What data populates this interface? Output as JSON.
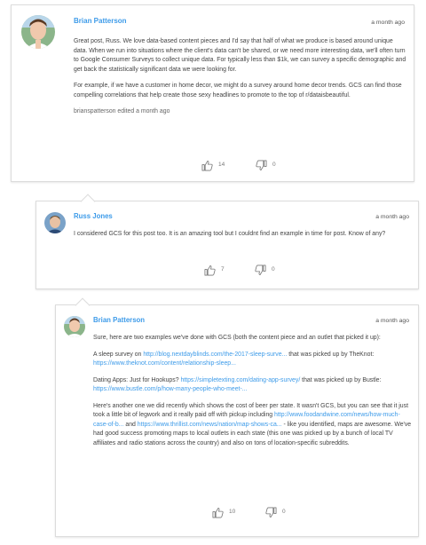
{
  "comments": [
    {
      "author": "Brian Patterson",
      "time": "a month ago",
      "paragraphs": [
        "Great post, Russ. We love data-based content pieces and I'd say that half of what we produce is based around unique data. When we run into situations where the client's data can't be shared, or we need more interesting data, we'll often turn to Google Consumer Surveys to collect unique data. For typically less than $1k, we can survey a specific demographic and get back the statistically significant data we were looking for.",
        "For example, if we have a customer in home decor, we might do a survey around home decor trends. GCS can find those compelling correlations that help create those sexy headlines to promote to the top of r/dataisbeautiful."
      ],
      "edited": "brianspatterson edited a month ago",
      "upvotes": "14",
      "downvotes": "0"
    },
    {
      "author": "Russ Jones",
      "time": "a month ago",
      "paragraphs": [
        "I considered GCS for this post too. It is an amazing tool but I couldnt find an example in time for post. Know of any?"
      ],
      "upvotes": "7",
      "downvotes": "0"
    },
    {
      "author": "Brian Patterson",
      "time": "a month ago",
      "p1": "Sure, here are two examples we've done with GCS (both the content piece and an outlet that picked it up):",
      "p2": {
        "t1": "A sleep survey on ",
        "l1": "http://blog.nextdayblinds.com/the-2017-sleep-surve...",
        "t2": " that was picked up by TheKnot: ",
        "l2": "https://www.theknot.com/content/relationship-sleep..."
      },
      "p3": {
        "t1": "Dating Apps: Just for Hookups? ",
        "l1": "https://simpletexting.com/dating-app-survey/",
        "t2": " that was picked up by Bustle: ",
        "l2": "https://www.bustle.com/p/how-many-people-who-meet-..."
      },
      "p4": {
        "t1": "Here's another one we did recently which shows the cost of beer per state. It wasn't GCS, but you can see that it just took a little bit of legwork and it really paid off with pickup including ",
        "l1": "http://www.foodandwine.com/news/how-much-case-of-b...",
        "t2": " and ",
        "l2": "https://www.thrillist.com/news/nation/map-shows-ca...",
        "t3": " - like you identified, maps are awesome. We've had good success promoting maps to local outlets in each state (this one was picked up by a bunch of local TV affiliates and radio stations across the country) and also on tons of location-specific subreddits."
      },
      "upvotes": "10",
      "downvotes": "0"
    }
  ]
}
